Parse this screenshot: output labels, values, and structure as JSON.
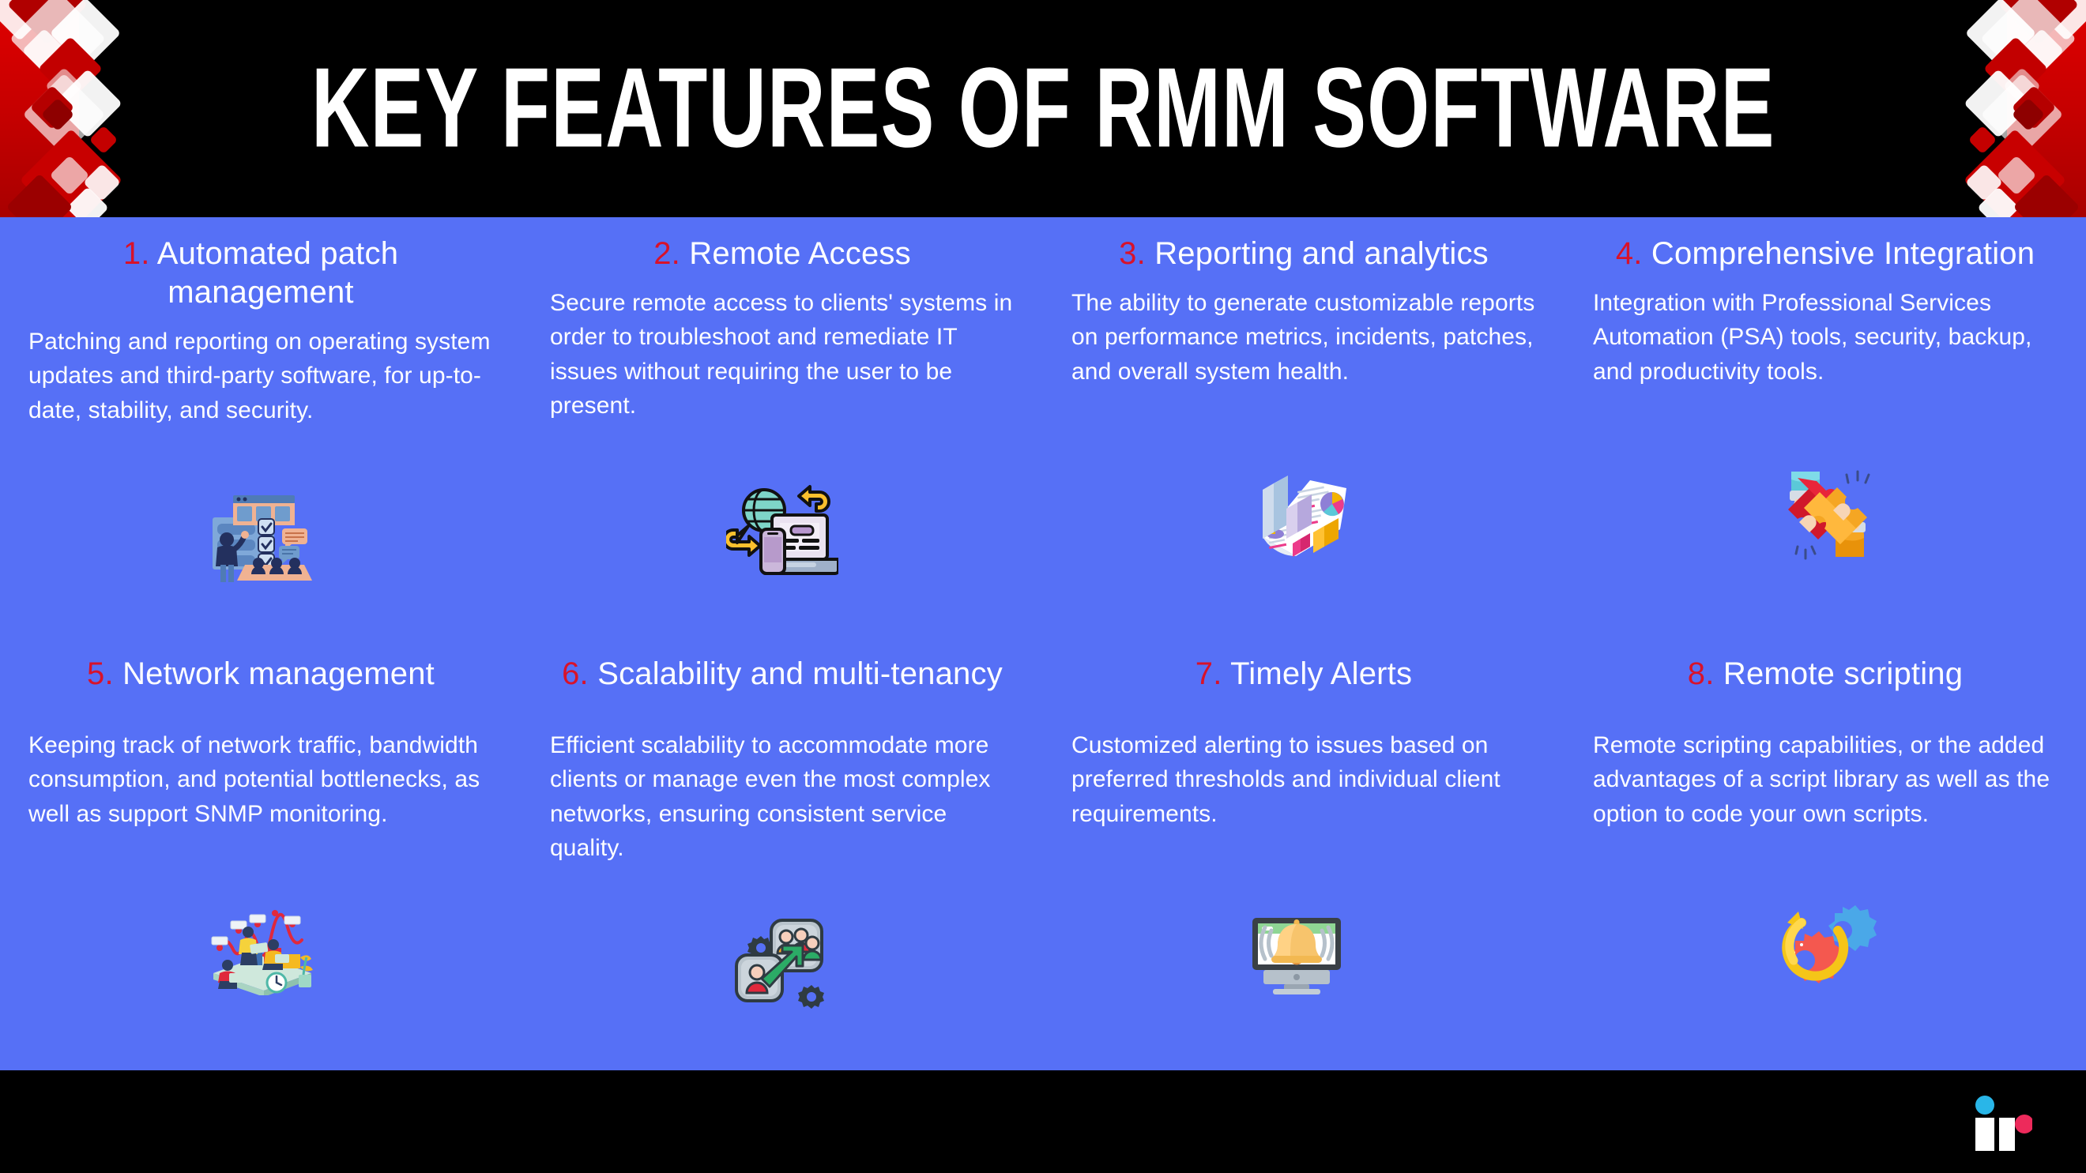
{
  "header": {
    "title": "KEY FEATURES OF RMM SOFTWARE",
    "background_color": "#000000",
    "accent_color": "#d8122a"
  },
  "theme": {
    "page_background": "#5670f6",
    "number_color": "#d8122a",
    "text_color": "#ffffff",
    "footer_background": "#000000"
  },
  "features": [
    {
      "number": "1.",
      "title": "Automated patch management",
      "body": "Patching and reporting on operating system updates and third-party software, for up-to-date, stability, and security.",
      "icon": "patch-management-icon"
    },
    {
      "number": "2.",
      "title": "Remote Access",
      "body": "Secure remote access to clients' systems in order to troubleshoot and remediate IT issues without requiring the user to be present.",
      "icon": "remote-access-icon"
    },
    {
      "number": "3.",
      "title": "Reporting and analytics",
      "body": "The ability to generate customizable reports on performance metrics, incidents, patches, and overall system health.",
      "icon": "reporting-analytics-icon"
    },
    {
      "number": "4.",
      "title": "Comprehensive Integration",
      "body": "Integration with Professional Services Automation (PSA) tools, security, backup, and productivity tools.",
      "icon": "puzzle-integration-icon"
    },
    {
      "number": "5.",
      "title": "Network management",
      "body": "Keeping track of network traffic, bandwidth consumption, and potential bottlenecks, as well as support SNMP monitoring.",
      "icon": "network-management-icon"
    },
    {
      "number": "6.",
      "title": "Scalability and multi-tenancy",
      "body": "Efficient scalability to accommodate more clients or manage even the most complex networks, ensuring consistent service quality.",
      "icon": "scalability-users-icon"
    },
    {
      "number": "7.",
      "title": "Timely Alerts",
      "body": "Customized alerting to issues based on preferred thresholds and individual client requirements.",
      "icon": "alert-bell-monitor-icon"
    },
    {
      "number": "8.",
      "title": "Remote scripting",
      "body": "Remote scripting capabilities, or the added advantages of a script library as well as the option to code your own scripts.",
      "icon": "gears-refresh-icon"
    }
  ],
  "footer": {
    "logo_name": "brand-logo",
    "logo_dot_colors": [
      "#29b6e8",
      "#ed2a5b"
    ]
  }
}
